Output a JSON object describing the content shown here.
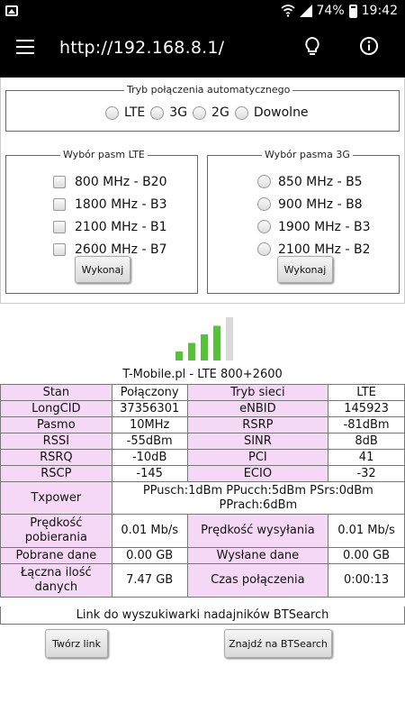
{
  "status_bar": {
    "battery": "74%",
    "time": "19:42"
  },
  "app_bar": {
    "url": "http://192.168.8.1/"
  },
  "mode": {
    "legend": "Tryb połączenia automatycznego",
    "options": [
      "LTE",
      "3G",
      "2G",
      "Dowolne"
    ]
  },
  "lte_bands": {
    "legend": "Wybór pasm LTE",
    "options": [
      "800 MHz - B20",
      "1800 MHz - B3",
      "2100 MHz - B1",
      "2600 MHz - B7"
    ],
    "button": "Wykonaj"
  },
  "bands_3g": {
    "legend": "Wybór pasma 3G",
    "options": [
      "850 MHz - B5",
      "900 MHz - B8",
      "1900 MHz - B3",
      "2100 MHz - B2"
    ],
    "button": "Wykonaj"
  },
  "signal": {
    "bars_active": 4,
    "bars_total": 5
  },
  "operator": "T-Mobile.pl - LTE 800+2600",
  "table": {
    "r1": [
      "Stan",
      "Połączony",
      "Tryb sieci",
      "LTE"
    ],
    "r2": [
      "LongCID",
      "37356301",
      "eNBID",
      "145923"
    ],
    "r3": [
      "Pasmo",
      "10MHz",
      "RSRP",
      "-81dBm"
    ],
    "r4": [
      "RSSI",
      "-55dBm",
      "SINR",
      "8dB"
    ],
    "r5": [
      "RSRQ",
      "-10dB",
      "PCI",
      "41"
    ],
    "r6": [
      "RSCP",
      "-145",
      "ECIO",
      "-32"
    ],
    "txpower_label": "Txpower",
    "txpower_value": "PPusch:1dBm PPucch:5dBm PSrs:0dBm PPrach:6dBm",
    "r8": [
      "Prędkość pobierania",
      "0.01 Mb/s",
      "Prędkość wysyłania",
      "0.01 Mb/s"
    ],
    "r9": [
      "Pobrane dane",
      "0.00 GB",
      "Wysłane dane",
      "0.00 GB"
    ],
    "r10": [
      "Łączna ilość danych",
      "7.47 GB",
      "Czas połączenia",
      "0:00:13"
    ]
  },
  "link_text": "Link do wyszukiwarki nadajników BTSearch",
  "buttons": {
    "create_link": "Twórz link",
    "find_bts": "Znajdź na BTSearch"
  },
  "colors": {
    "label_bg": "#f5d8f5",
    "signal_active": "#55c238",
    "signal_inactive": "#d9d9d9"
  }
}
